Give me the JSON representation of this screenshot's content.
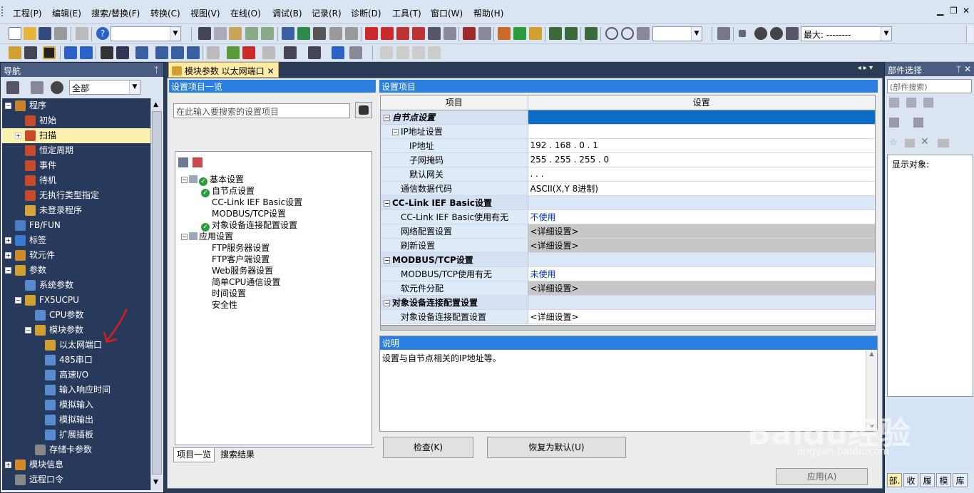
{
  "menu": {
    "items": [
      "工程(P)",
      "编辑(E)",
      "搜索/替换(F)",
      "转换(C)",
      "视图(V)",
      "在线(O)",
      "调试(B)",
      "记录(R)",
      "诊断(D)",
      "工具(T)",
      "窗口(W)",
      "帮助(H)"
    ]
  },
  "toolbar": {
    "scan_label": "最大: --------"
  },
  "nav": {
    "title": "导航",
    "pin": "ᛘ",
    "filter": "全部",
    "tree": [
      {
        "label": "程序",
        "level": 0,
        "exp": "−",
        "icon": "program-folder-icon",
        "color": "#c9822a"
      },
      {
        "label": "初始",
        "level": 1,
        "exp": "",
        "icon": "program-icon",
        "color": "#c94a2a"
      },
      {
        "label": "扫描",
        "level": 1,
        "exp": "+",
        "icon": "program-icon",
        "color": "#c94a2a",
        "selected": true
      },
      {
        "label": "恒定周期",
        "level": 1,
        "exp": "",
        "icon": "program-icon",
        "color": "#c94a2a"
      },
      {
        "label": "事件",
        "level": 1,
        "exp": "",
        "icon": "program-icon",
        "color": "#c94a2a"
      },
      {
        "label": "待机",
        "level": 1,
        "exp": "",
        "icon": "program-icon",
        "color": "#c94a2a"
      },
      {
        "label": "无执行类型指定",
        "level": 1,
        "exp": "",
        "icon": "program-icon",
        "color": "#c94a2a"
      },
      {
        "label": "未登录程序",
        "level": 1,
        "exp": "",
        "icon": "program-icon",
        "color": "#d7a43a"
      },
      {
        "label": "FB/FUN",
        "level": 0,
        "exp": "",
        "icon": "fb-icon",
        "color": "#4a7ec9"
      },
      {
        "label": "标签",
        "level": 0,
        "exp": "+",
        "icon": "label-icon",
        "color": "#3a7ad0"
      },
      {
        "label": "软元件",
        "level": 0,
        "exp": "+",
        "icon": "device-icon",
        "color": "#d08a2a"
      },
      {
        "label": "参数",
        "level": 0,
        "exp": "−",
        "icon": "parameter-icon",
        "color": "#d0a030"
      },
      {
        "label": "系统参数",
        "level": 1,
        "exp": "",
        "icon": "parameter-icon",
        "color": "#5a8ad0"
      },
      {
        "label": "FX5UCPU",
        "level": 1,
        "exp": "−",
        "icon": "parameter-icon",
        "color": "#d0a030"
      },
      {
        "label": "CPU参数",
        "level": 2,
        "exp": "",
        "icon": "parameter-icon",
        "color": "#5a8ad0"
      },
      {
        "label": "模块参数",
        "level": 2,
        "exp": "−",
        "icon": "parameter-icon",
        "color": "#d0a030"
      },
      {
        "label": "以太网端口",
        "level": 3,
        "exp": "",
        "icon": "parameter-icon",
        "color": "#d0a030"
      },
      {
        "label": "485串口",
        "level": 3,
        "exp": "",
        "icon": "parameter-icon",
        "color": "#5a8ad0"
      },
      {
        "label": "高速I/O",
        "level": 3,
        "exp": "",
        "icon": "parameter-icon",
        "color": "#5a8ad0"
      },
      {
        "label": "输入响应时间",
        "level": 3,
        "exp": "",
        "icon": "parameter-icon",
        "color": "#5a8ad0"
      },
      {
        "label": "模拟输入",
        "level": 3,
        "exp": "",
        "icon": "parameter-icon",
        "color": "#5a8ad0"
      },
      {
        "label": "模拟输出",
        "level": 3,
        "exp": "",
        "icon": "parameter-icon",
        "color": "#5a8ad0"
      },
      {
        "label": "扩展插板",
        "level": 3,
        "exp": "",
        "icon": "parameter-icon",
        "color": "#5a8ad0"
      },
      {
        "label": "存储卡参数",
        "level": 2,
        "exp": "",
        "icon": "memory-card-icon",
        "color": "#888888"
      },
      {
        "label": "模块信息",
        "level": 0,
        "exp": "+",
        "icon": "module-info-icon",
        "color": "#d08a2a"
      },
      {
        "label": "远程口令",
        "level": 0,
        "exp": "",
        "icon": "remote-password-icon",
        "color": "#888888"
      }
    ]
  },
  "doc_tab": {
    "title": "模块参数 以太网端口",
    "close": "✕"
  },
  "setting_list": {
    "title": "设置项目一览",
    "search_placeholder": "在此输入要搜索的设置项目",
    "tree": [
      {
        "label": "基本设置",
        "level": 0,
        "check": true,
        "exp": "−"
      },
      {
        "label": "自节点设置",
        "level": 1,
        "check": true
      },
      {
        "label": "CC-Link IEF Basic设置",
        "level": 1,
        "check": false
      },
      {
        "label": "MODBUS/TCP设置",
        "level": 1,
        "check": false
      },
      {
        "label": "对象设备连接配置设置",
        "level": 1,
        "check": true
      },
      {
        "label": "应用设置",
        "level": 0,
        "check": false,
        "exp": "−"
      },
      {
        "label": "FTP服务器设置",
        "level": 1,
        "check": false
      },
      {
        "label": "FTP客户端设置",
        "level": 1,
        "check": false
      },
      {
        "label": "Web服务器设置",
        "level": 1,
        "check": false
      },
      {
        "label": "简单CPU通信设置",
        "level": 1,
        "check": false
      },
      {
        "label": "时间设置",
        "level": 1,
        "check": false
      },
      {
        "label": "安全性",
        "level": 1,
        "check": false
      }
    ],
    "tabs": [
      "项目一览",
      "搜索结果"
    ]
  },
  "settings": {
    "title": "设置项目",
    "col_item": "项目",
    "col_setting": "设置",
    "rows": [
      {
        "item": "自节点设置",
        "value": "",
        "type": "section",
        "sel": true,
        "indent": 0,
        "exp": "−"
      },
      {
        "item": "IP地址设置",
        "value": "",
        "type": "sub",
        "indent": 1,
        "exp": "−"
      },
      {
        "item": "IP地址",
        "value": "192 . 168 .  0 .  1",
        "indent": 3
      },
      {
        "item": "子网掩码",
        "value": "255 . 255 . 255 .  0",
        "indent": 3
      },
      {
        "item": "默认网关",
        "value": "   .   .   .",
        "indent": 3
      },
      {
        "item": "通信数据代码",
        "value": "ASCII(X,Y 8进制)",
        "indent": 2
      },
      {
        "item": "CC-Link IEF Basic设置",
        "value": "",
        "type": "section",
        "indent": 0,
        "exp": "−"
      },
      {
        "item": "CC-Link IEF Basic使用有无",
        "value": "不使用",
        "blue": true,
        "indent": 2
      },
      {
        "item": "网络配置设置",
        "value": "<详细设置>",
        "grey": true,
        "indent": 2
      },
      {
        "item": "刷新设置",
        "value": "<详细设置>",
        "grey": true,
        "indent": 2
      },
      {
        "item": "MODBUS/TCP设置",
        "value": "",
        "type": "section",
        "indent": 0,
        "exp": "−"
      },
      {
        "item": "MODBUS/TCP使用有无",
        "value": "未使用",
        "blue": true,
        "indent": 2
      },
      {
        "item": "软元件分配",
        "value": "<详细设置>",
        "grey": true,
        "indent": 2
      },
      {
        "item": "对象设备连接配置设置",
        "value": "",
        "type": "section",
        "indent": 0,
        "exp": "−"
      },
      {
        "item": "对象设备连接配置设置",
        "value": "<详细设置>",
        "indent": 2
      }
    ]
  },
  "explain": {
    "title": "说明",
    "text": "设置与自节点相关的IP地址等。"
  },
  "buttons": {
    "check": "检查(K)",
    "restore": "恢复为默认(U)",
    "apply": "应用(A)"
  },
  "parts": {
    "title": "部件选择",
    "search": "(部件搜索)",
    "display_label": "显示对象:",
    "tabs": [
      "部.",
      "收",
      "履",
      "模",
      "库"
    ]
  },
  "watermark": {
    "brand": "Baidu经验",
    "url": "jingyan.baidu.com"
  }
}
